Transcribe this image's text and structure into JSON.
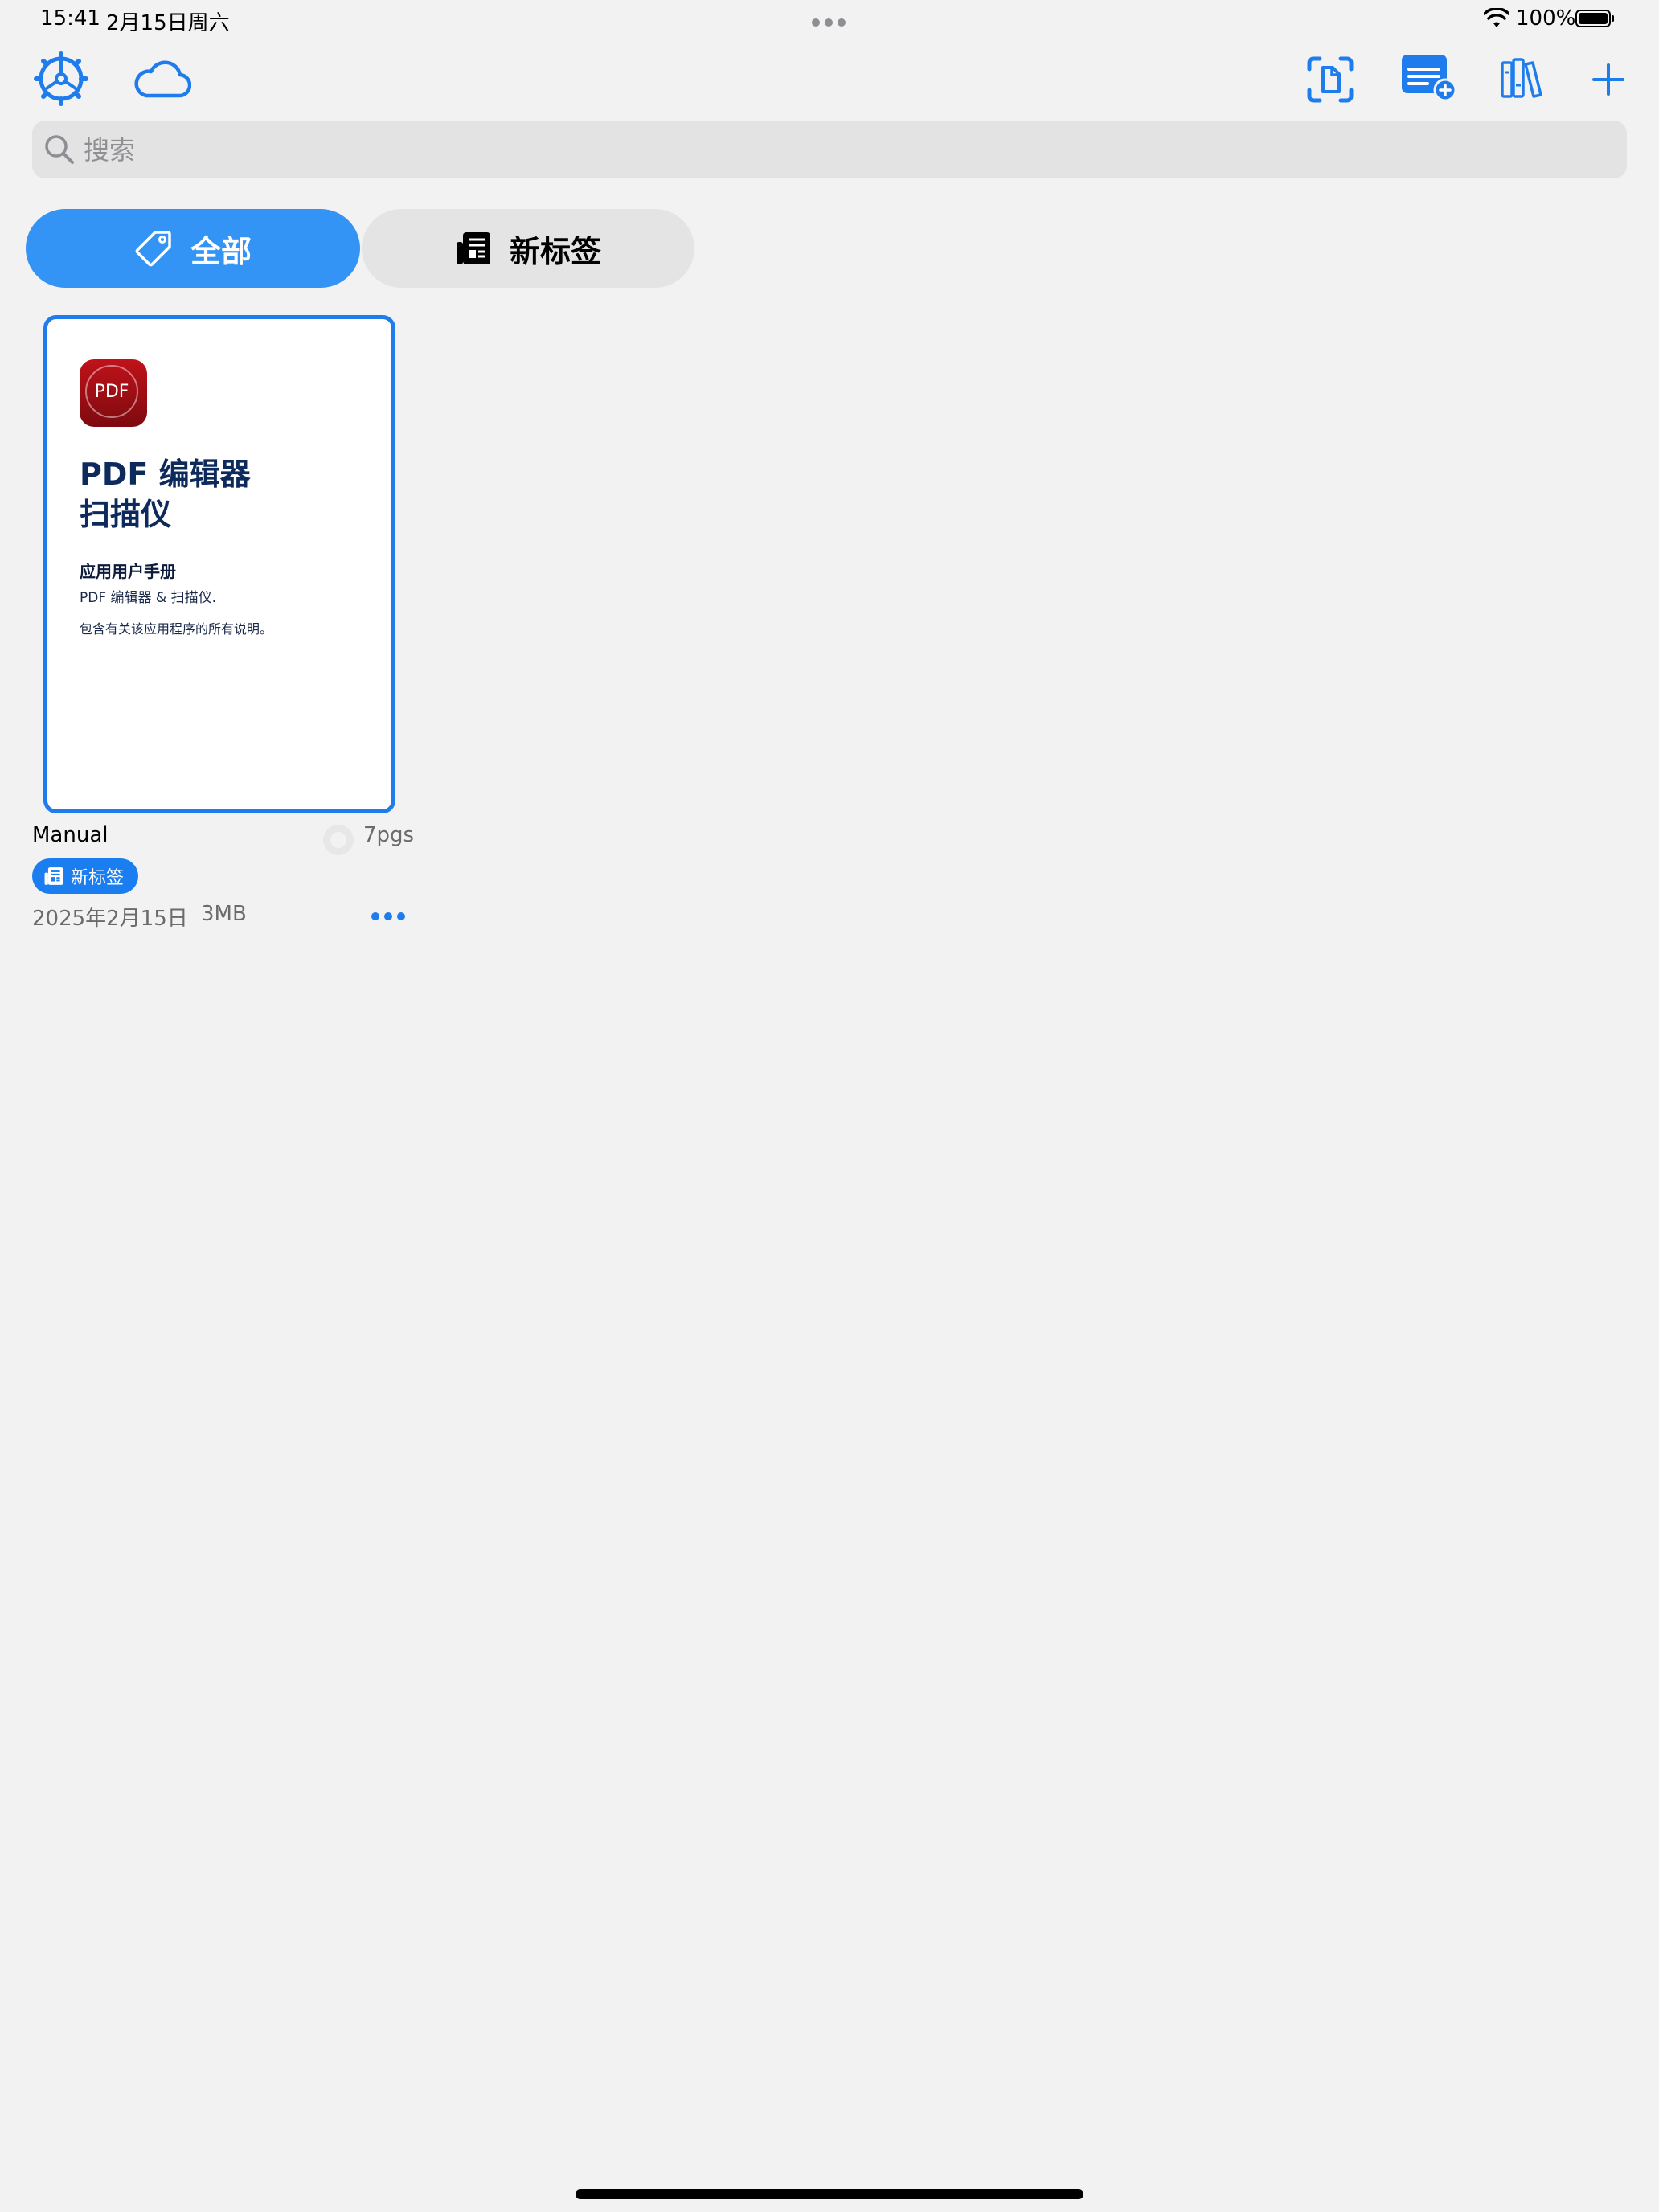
{
  "status_bar": {
    "time": "15:41",
    "date": "2月15日周六",
    "battery": "100%"
  },
  "toolbar": {
    "left_icons": [
      "settings-icon",
      "cloud-icon"
    ],
    "right_icons": [
      "scan-document-icon",
      "new-note-icon",
      "library-icon",
      "add-icon"
    ],
    "accent_color": "#1f7cec"
  },
  "search": {
    "placeholder": "搜索",
    "value": ""
  },
  "tags": [
    {
      "label": "全部",
      "selected": true,
      "icon": "tag-icon"
    },
    {
      "label": "新标签",
      "selected": false,
      "icon": "newspaper-icon"
    }
  ],
  "documents": [
    {
      "cover": {
        "app_icon_text": "PDF",
        "title": "PDF 编辑器\n扫描仪",
        "subtitle": "应用用户手册",
        "line1": "PDF 编辑器 & 扫描仪.",
        "line2": "包含有关该应用程序的所有说明。"
      },
      "name": "Manual",
      "pages": "7pgs",
      "tag": "新标签",
      "date": "2025年2月15日",
      "size": "3MB"
    }
  ]
}
